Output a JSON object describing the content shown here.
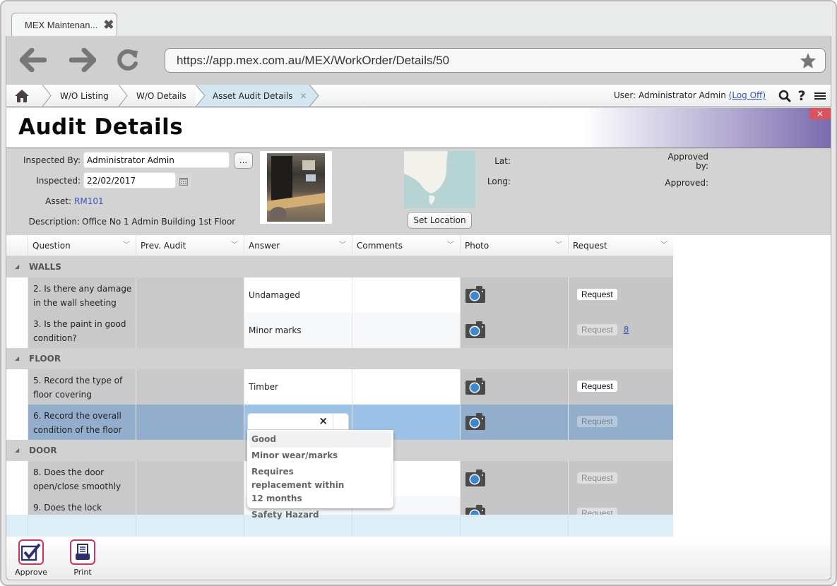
{
  "browser": {
    "tab_title": "MEX Maintenan...",
    "url": "https://app.mex.com.au/MEX/WorkOrder/Details/50"
  },
  "breadcrumb": {
    "items": [
      "W/O Listing",
      "W/O Details",
      "Asset Audit Details"
    ]
  },
  "user": {
    "label": "User: Administrator Admin",
    "logoff": "(Log Off)"
  },
  "page": {
    "title": "Audit Details",
    "close_label": "×"
  },
  "form": {
    "inspected_by_label": "Inspected By:",
    "inspected_by_value": "Administrator Admin",
    "lookup_button": "...",
    "inspected_label": "Inspected:",
    "inspected_value": "22/02/2017",
    "asset_label": "Asset:",
    "asset_value": "RM101",
    "description_label": "Description:",
    "description_value": "Office No 1 Admin Building 1st Floor",
    "set_location_button": "Set Location",
    "lat_label": "Lat:",
    "long_label": "Long:",
    "approved_by_label": "Approved by:",
    "approved_label": "Approved:"
  },
  "grid": {
    "columns": [
      "Question",
      "Prev. Audit",
      "Answer",
      "Comments",
      "Photo",
      "Request"
    ],
    "groups": [
      {
        "name": "WALLS",
        "rows": [
          {
            "question": "2. Is there any damage in the wall sheeting",
            "prev": "",
            "answer": "Undamaged",
            "comments": "",
            "request_label": "Request",
            "request_enabled": true,
            "request_count": ""
          },
          {
            "question": "3. Is the paint in good condition?",
            "prev": "",
            "answer": "Minor marks",
            "comments": "",
            "request_label": "Request",
            "request_enabled": false,
            "request_count": "8"
          }
        ]
      },
      {
        "name": "FLOOR",
        "rows": [
          {
            "question": "5. Record the type of floor covering",
            "prev": "",
            "answer": "Timber",
            "comments": "",
            "request_label": "Request",
            "request_enabled": true,
            "request_count": ""
          },
          {
            "question": "6. Record the overall condition of the floor",
            "prev": "",
            "answer": "",
            "comments": "",
            "request_label": "Request",
            "request_enabled": false,
            "request_count": ""
          }
        ]
      },
      {
        "name": "DOOR",
        "rows": [
          {
            "question": "8. Does the door open/close smoothly",
            "prev": "",
            "answer": "",
            "comments": "",
            "request_label": "Request",
            "request_enabled": false,
            "request_count": ""
          },
          {
            "question": "9. Does the lock",
            "prev": "",
            "answer": "",
            "comments": "",
            "request_label": "Request",
            "request_enabled": false,
            "request_count": ""
          }
        ]
      }
    ]
  },
  "dropdown": {
    "value": "",
    "clear_icon": "×",
    "options": [
      "Good",
      "Minor wear/marks",
      "Requires replacement within 12 months",
      "Safety Hazard"
    ],
    "highlighted": "Good"
  },
  "footer": {
    "approve_label": "Approve",
    "print_label": "Print"
  },
  "colors": {
    "accent_purple": "#6e5fa6",
    "selected_row": "#93adcd",
    "footer_icon_border": "#c8365d",
    "link_blue": "#3358b6"
  }
}
